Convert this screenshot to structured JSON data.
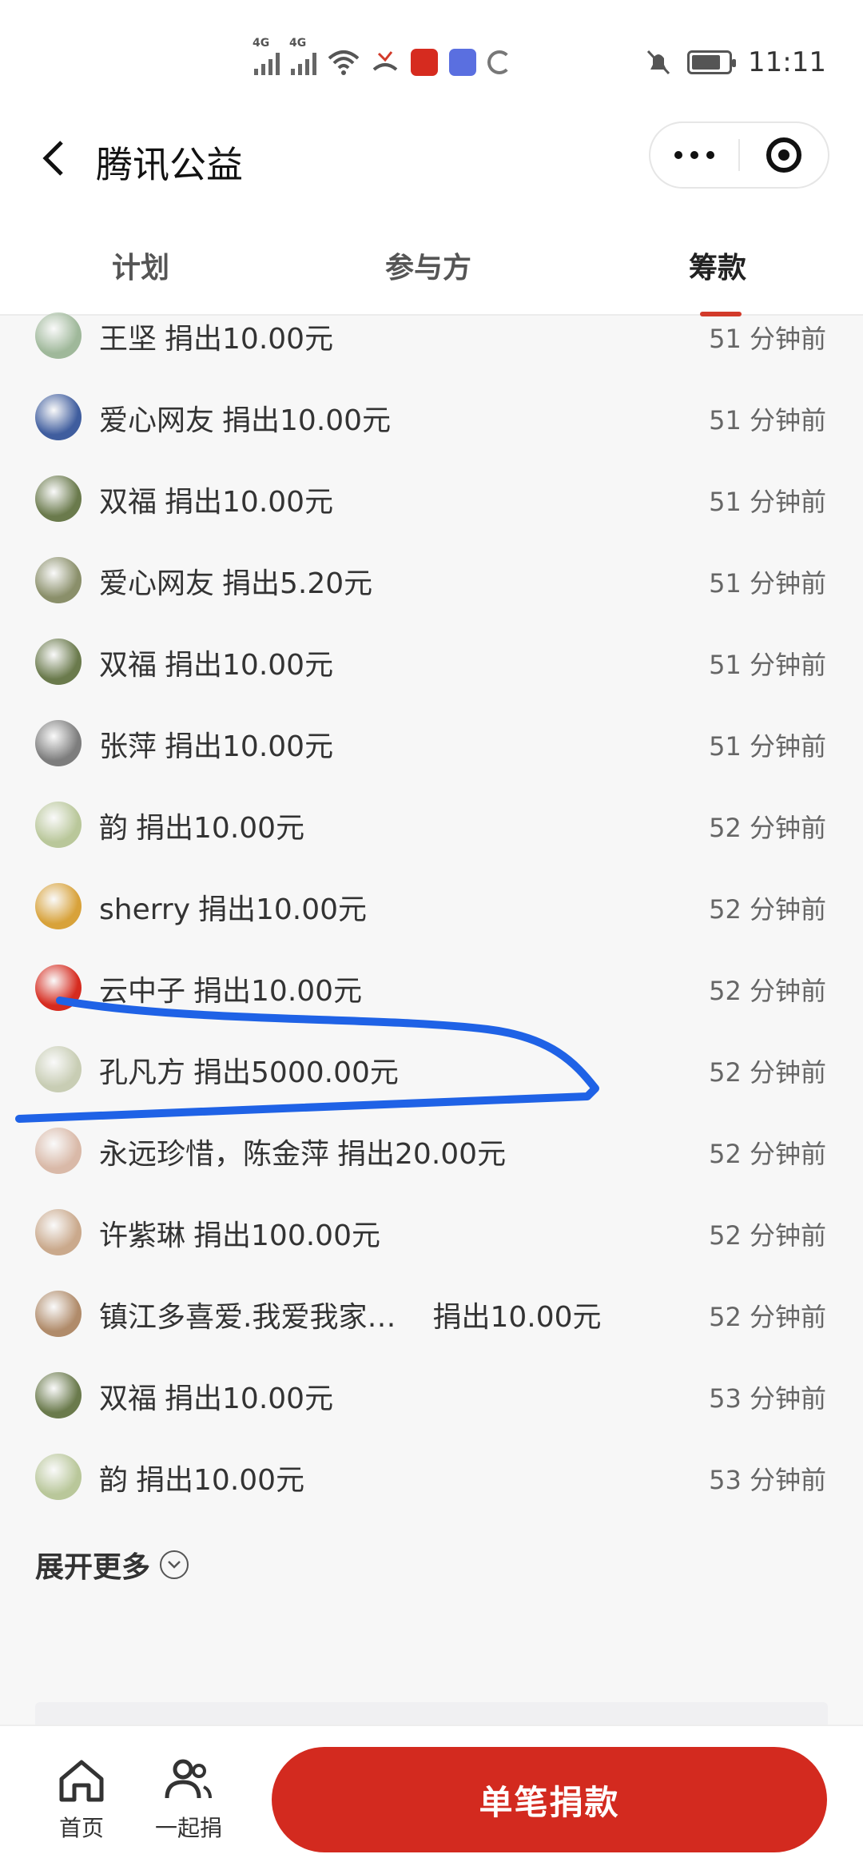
{
  "status_bar": {
    "network_1": "4G",
    "network_2": "4G",
    "time": "11:11"
  },
  "header": {
    "title": "腾讯公益"
  },
  "tabs": [
    {
      "label": "计划",
      "active": false
    },
    {
      "label": "参与方",
      "active": false
    },
    {
      "label": "筹款",
      "active": true
    }
  ],
  "donations": [
    {
      "name": "王坚",
      "amount": "捐出10.00元",
      "time": "51 分钟前",
      "avatar": "#9fb89a"
    },
    {
      "name": "爱心网友",
      "amount": "捐出10.00元",
      "time": "51 分钟前",
      "avatar": "#3f5d9e"
    },
    {
      "name": "双福",
      "amount": "捐出10.00元",
      "time": "51 分钟前",
      "avatar": "#6a7a4c"
    },
    {
      "name": "爱心网友",
      "amount": "捐出5.20元",
      "time": "51 分钟前",
      "avatar": "#8a8f6a"
    },
    {
      "name": "双福",
      "amount": "捐出10.00元",
      "time": "51 分钟前",
      "avatar": "#6a7a4c"
    },
    {
      "name": "张萍",
      "amount": "捐出10.00元",
      "time": "51 分钟前",
      "avatar": "#7d7d7d"
    },
    {
      "name": "韵",
      "amount": "捐出10.00元",
      "time": "52 分钟前",
      "avatar": "#b9c79a"
    },
    {
      "name": "sherry",
      "amount": "捐出10.00元",
      "time": "52 分钟前",
      "avatar": "#d8a23a"
    },
    {
      "name": "云中子",
      "amount": "捐出10.00元",
      "time": "52 分钟前",
      "avatar": "#d62b1f"
    },
    {
      "name": "孔凡方",
      "amount": "捐出5000.00元",
      "time": "52 分钟前",
      "avatar": "#c8cdb4"
    },
    {
      "name": "永远珍惜，陈金萍",
      "amount": "捐出20.00元",
      "time": "52 分钟前",
      "avatar": "#d9b9a8"
    },
    {
      "name": "许紫琳",
      "amount": "捐出100.00元",
      "time": "52 分钟前",
      "avatar": "#caa98c"
    },
    {
      "name": "镇江多喜爱.我爱我家…",
      "amount": "捐出10.00元",
      "time": "52 分钟前",
      "avatar": "#b08b6a"
    },
    {
      "name": "双福",
      "amount": "捐出10.00元",
      "time": "53 分钟前",
      "avatar": "#6a7a4c"
    },
    {
      "name": "韵",
      "amount": "捐出10.00元",
      "time": "53 分钟前",
      "avatar": "#b9c79a"
    }
  ],
  "expand_label": "展开更多",
  "bottom_nav": {
    "home_label": "首页",
    "together_label": "一起捐",
    "donate_label": "单笔捐款"
  },
  "colors": {
    "accent": "#d32a1f",
    "highlight_stroke": "#1f62e6"
  }
}
